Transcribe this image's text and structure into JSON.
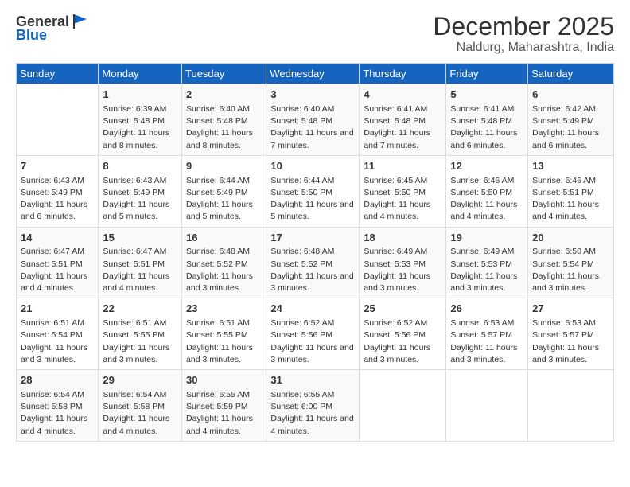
{
  "header": {
    "logo_general": "General",
    "logo_blue": "Blue",
    "month_title": "December 2025",
    "location": "Naldurg, Maharashtra, India"
  },
  "columns": [
    "Sunday",
    "Monday",
    "Tuesday",
    "Wednesday",
    "Thursday",
    "Friday",
    "Saturday"
  ],
  "weeks": [
    [
      {
        "day": "",
        "sunrise": "",
        "sunset": "",
        "daylight": ""
      },
      {
        "day": "1",
        "sunrise": "Sunrise: 6:39 AM",
        "sunset": "Sunset: 5:48 PM",
        "daylight": "Daylight: 11 hours and 8 minutes."
      },
      {
        "day": "2",
        "sunrise": "Sunrise: 6:40 AM",
        "sunset": "Sunset: 5:48 PM",
        "daylight": "Daylight: 11 hours and 8 minutes."
      },
      {
        "day": "3",
        "sunrise": "Sunrise: 6:40 AM",
        "sunset": "Sunset: 5:48 PM",
        "daylight": "Daylight: 11 hours and 7 minutes."
      },
      {
        "day": "4",
        "sunrise": "Sunrise: 6:41 AM",
        "sunset": "Sunset: 5:48 PM",
        "daylight": "Daylight: 11 hours and 7 minutes."
      },
      {
        "day": "5",
        "sunrise": "Sunrise: 6:41 AM",
        "sunset": "Sunset: 5:48 PM",
        "daylight": "Daylight: 11 hours and 6 minutes."
      },
      {
        "day": "6",
        "sunrise": "Sunrise: 6:42 AM",
        "sunset": "Sunset: 5:49 PM",
        "daylight": "Daylight: 11 hours and 6 minutes."
      }
    ],
    [
      {
        "day": "7",
        "sunrise": "Sunrise: 6:43 AM",
        "sunset": "Sunset: 5:49 PM",
        "daylight": "Daylight: 11 hours and 6 minutes."
      },
      {
        "day": "8",
        "sunrise": "Sunrise: 6:43 AM",
        "sunset": "Sunset: 5:49 PM",
        "daylight": "Daylight: 11 hours and 5 minutes."
      },
      {
        "day": "9",
        "sunrise": "Sunrise: 6:44 AM",
        "sunset": "Sunset: 5:49 PM",
        "daylight": "Daylight: 11 hours and 5 minutes."
      },
      {
        "day": "10",
        "sunrise": "Sunrise: 6:44 AM",
        "sunset": "Sunset: 5:50 PM",
        "daylight": "Daylight: 11 hours and 5 minutes."
      },
      {
        "day": "11",
        "sunrise": "Sunrise: 6:45 AM",
        "sunset": "Sunset: 5:50 PM",
        "daylight": "Daylight: 11 hours and 4 minutes."
      },
      {
        "day": "12",
        "sunrise": "Sunrise: 6:46 AM",
        "sunset": "Sunset: 5:50 PM",
        "daylight": "Daylight: 11 hours and 4 minutes."
      },
      {
        "day": "13",
        "sunrise": "Sunrise: 6:46 AM",
        "sunset": "Sunset: 5:51 PM",
        "daylight": "Daylight: 11 hours and 4 minutes."
      }
    ],
    [
      {
        "day": "14",
        "sunrise": "Sunrise: 6:47 AM",
        "sunset": "Sunset: 5:51 PM",
        "daylight": "Daylight: 11 hours and 4 minutes."
      },
      {
        "day": "15",
        "sunrise": "Sunrise: 6:47 AM",
        "sunset": "Sunset: 5:51 PM",
        "daylight": "Daylight: 11 hours and 4 minutes."
      },
      {
        "day": "16",
        "sunrise": "Sunrise: 6:48 AM",
        "sunset": "Sunset: 5:52 PM",
        "daylight": "Daylight: 11 hours and 3 minutes."
      },
      {
        "day": "17",
        "sunrise": "Sunrise: 6:48 AM",
        "sunset": "Sunset: 5:52 PM",
        "daylight": "Daylight: 11 hours and 3 minutes."
      },
      {
        "day": "18",
        "sunrise": "Sunrise: 6:49 AM",
        "sunset": "Sunset: 5:53 PM",
        "daylight": "Daylight: 11 hours and 3 minutes."
      },
      {
        "day": "19",
        "sunrise": "Sunrise: 6:49 AM",
        "sunset": "Sunset: 5:53 PM",
        "daylight": "Daylight: 11 hours and 3 minutes."
      },
      {
        "day": "20",
        "sunrise": "Sunrise: 6:50 AM",
        "sunset": "Sunset: 5:54 PM",
        "daylight": "Daylight: 11 hours and 3 minutes."
      }
    ],
    [
      {
        "day": "21",
        "sunrise": "Sunrise: 6:51 AM",
        "sunset": "Sunset: 5:54 PM",
        "daylight": "Daylight: 11 hours and 3 minutes."
      },
      {
        "day": "22",
        "sunrise": "Sunrise: 6:51 AM",
        "sunset": "Sunset: 5:55 PM",
        "daylight": "Daylight: 11 hours and 3 minutes."
      },
      {
        "day": "23",
        "sunrise": "Sunrise: 6:51 AM",
        "sunset": "Sunset: 5:55 PM",
        "daylight": "Daylight: 11 hours and 3 minutes."
      },
      {
        "day": "24",
        "sunrise": "Sunrise: 6:52 AM",
        "sunset": "Sunset: 5:56 PM",
        "daylight": "Daylight: 11 hours and 3 minutes."
      },
      {
        "day": "25",
        "sunrise": "Sunrise: 6:52 AM",
        "sunset": "Sunset: 5:56 PM",
        "daylight": "Daylight: 11 hours and 3 minutes."
      },
      {
        "day": "26",
        "sunrise": "Sunrise: 6:53 AM",
        "sunset": "Sunset: 5:57 PM",
        "daylight": "Daylight: 11 hours and 3 minutes."
      },
      {
        "day": "27",
        "sunrise": "Sunrise: 6:53 AM",
        "sunset": "Sunset: 5:57 PM",
        "daylight": "Daylight: 11 hours and 3 minutes."
      }
    ],
    [
      {
        "day": "28",
        "sunrise": "Sunrise: 6:54 AM",
        "sunset": "Sunset: 5:58 PM",
        "daylight": "Daylight: 11 hours and 4 minutes."
      },
      {
        "day": "29",
        "sunrise": "Sunrise: 6:54 AM",
        "sunset": "Sunset: 5:58 PM",
        "daylight": "Daylight: 11 hours and 4 minutes."
      },
      {
        "day": "30",
        "sunrise": "Sunrise: 6:55 AM",
        "sunset": "Sunset: 5:59 PM",
        "daylight": "Daylight: 11 hours and 4 minutes."
      },
      {
        "day": "31",
        "sunrise": "Sunrise: 6:55 AM",
        "sunset": "Sunset: 6:00 PM",
        "daylight": "Daylight: 11 hours and 4 minutes."
      },
      {
        "day": "",
        "sunrise": "",
        "sunset": "",
        "daylight": ""
      },
      {
        "day": "",
        "sunrise": "",
        "sunset": "",
        "daylight": ""
      },
      {
        "day": "",
        "sunrise": "",
        "sunset": "",
        "daylight": ""
      }
    ]
  ]
}
